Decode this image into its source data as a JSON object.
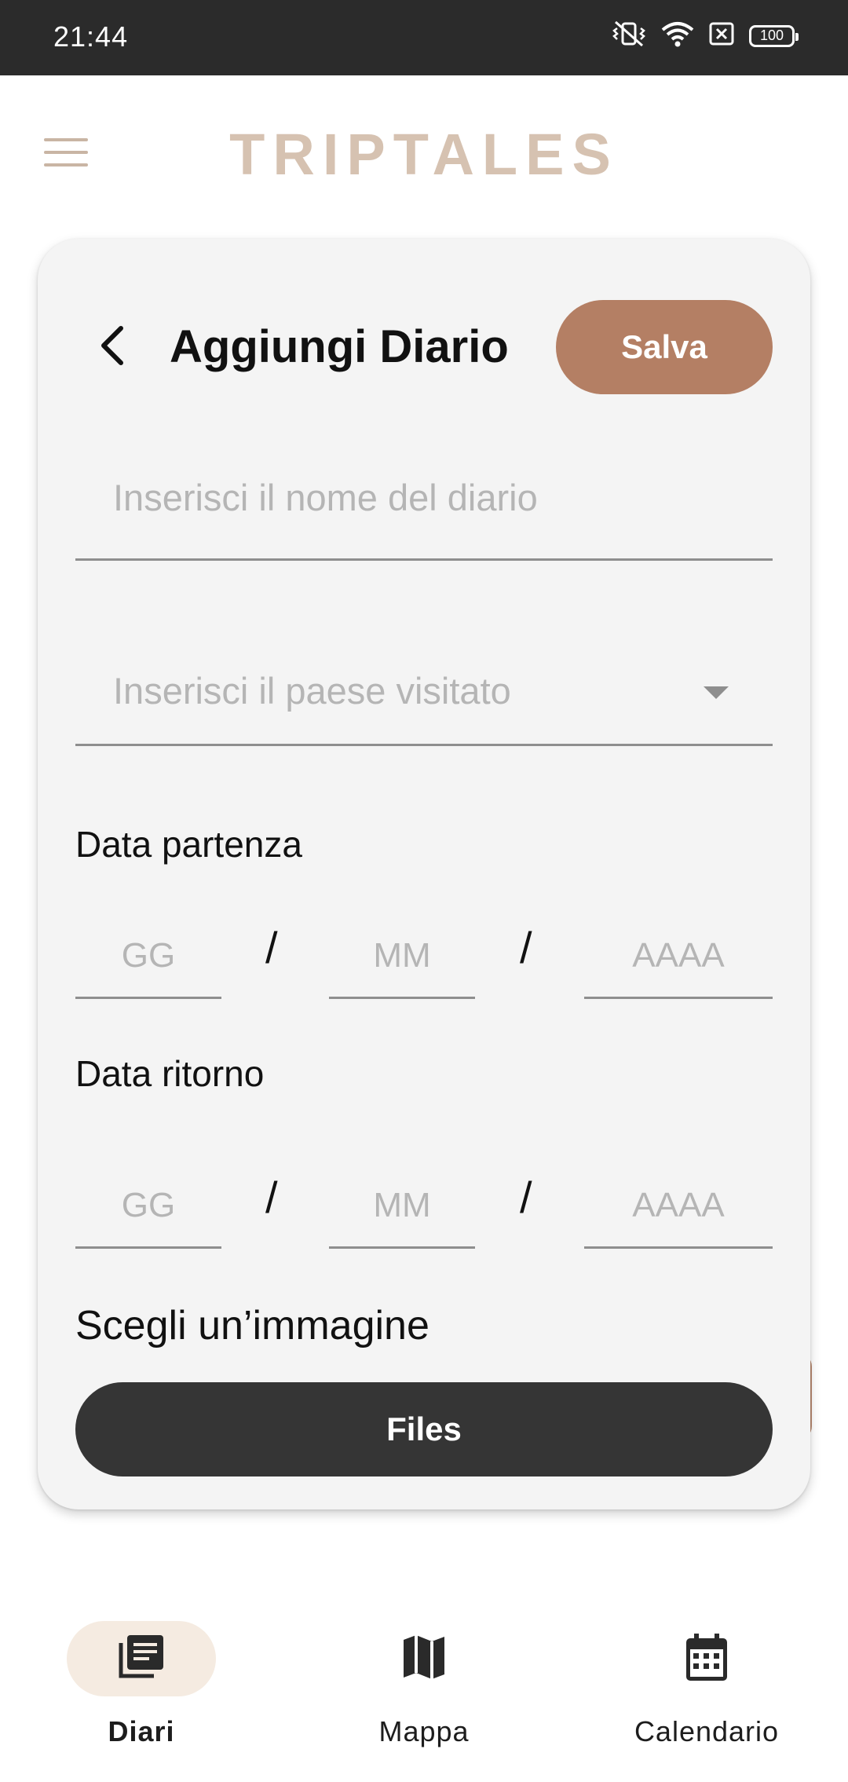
{
  "status_bar": {
    "time": "21:44",
    "battery": "100",
    "icons": [
      "vibrate-mute-icon",
      "wifi-icon",
      "sim-blocked-icon",
      "battery-icon"
    ]
  },
  "app_bar": {
    "brand": "TRIPTALES",
    "menu_icon": "hamburger-menu-icon"
  },
  "form": {
    "title": "Aggiungi Diario",
    "save_label": "Salva",
    "name_placeholder": "Inserisci il nome del diario",
    "country_placeholder": "Inserisci il paese visitato",
    "departure_label": "Data partenza",
    "return_label": "Data ritorno",
    "date_placeholders": {
      "day": "GG",
      "month": "MM",
      "year": "AAAA",
      "separator": "/"
    },
    "image_label": "Scegli un’immagine",
    "files_label": "Files"
  },
  "bottom_nav": {
    "items": [
      {
        "label": "Diari",
        "icon": "diaries-icon",
        "active": true
      },
      {
        "label": "Mappa",
        "icon": "map-icon",
        "active": false
      },
      {
        "label": "Calendario",
        "icon": "calendar-icon",
        "active": false
      }
    ]
  },
  "colors": {
    "accent": "#b47f64",
    "brand": "#d6c2b1",
    "dark_button": "#353535",
    "nav_active_bg": "#f5ebe1"
  }
}
